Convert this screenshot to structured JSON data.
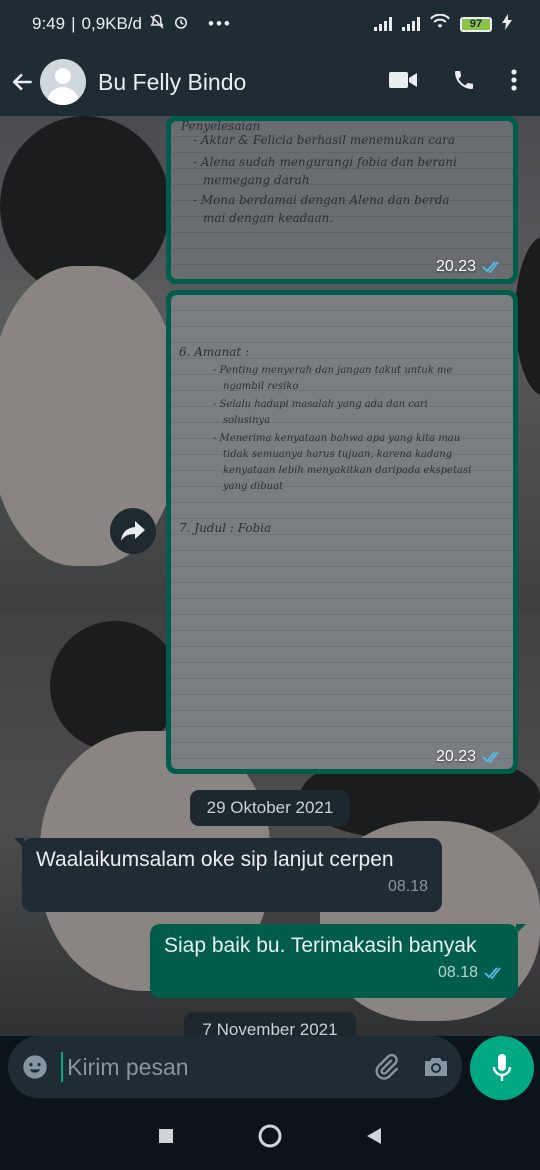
{
  "status_bar": {
    "time": "9:49",
    "network_speed": "0,9KB/d",
    "battery": "97",
    "icons": [
      "mute-icon",
      "alarm-icon",
      "more-dots-icon",
      "signal-icon",
      "signal-icon",
      "wifi-icon",
      "battery-icon",
      "charging-icon"
    ]
  },
  "header": {
    "contact_name": "Bu Felly Bindo",
    "icons": [
      "back-arrow-icon",
      "avatar-icon",
      "video-call-icon",
      "voice-call-icon",
      "menu-dots-icon"
    ]
  },
  "messages": {
    "image_1": {
      "time": "20.23",
      "handwriting": [
        "Penyelesaian",
        "- Aktar & Felicia berhasil menemukan cara",
        "- Alena sudah mengurangi fobia dan berani",
        "memegang darah",
        "- Mona berdamai dengan Alena dan berda",
        "mai dengan keadaan."
      ]
    },
    "image_2": {
      "time": "20.23",
      "handwriting": [
        "6. Amanat :",
        "- Penting menyerah dan jangan takut untuk me",
        "ngambil resiko",
        "- Selalu hadapi masalah yang ada dan cari",
        "solusinya",
        "- Menerima kenyataan bahwa apa yang kita mau",
        "tidak semuanya harus tujuan, karena kadang",
        "kenyataan lebih menyakitkan daripada ekspetasi",
        "yang dibuat",
        "7. Judul : Fobia"
      ]
    },
    "date_separator": "29 Oktober 2021",
    "incoming": {
      "text": "Waalaikumsalam oke sip lanjut cerpen",
      "time": "08.18"
    },
    "outgoing": {
      "text": "Siap baik bu. Terimakasih banyak",
      "time": "08.18"
    },
    "date_separator_2": "7 November 2021"
  },
  "composer": {
    "placeholder": "Kirim pesan",
    "icons": [
      "emoji-icon",
      "attach-icon",
      "camera-icon",
      "mic-icon"
    ]
  },
  "nav": {
    "icons": [
      "recent-apps-icon",
      "home-icon",
      "back-icon"
    ]
  },
  "colors": {
    "header_bg": "#1f2c34",
    "outgoing_bubble": "#005c4b",
    "incoming_bubble": "#1f2c34",
    "accent": "#00a884",
    "read_ticks": "#53bdeb"
  }
}
